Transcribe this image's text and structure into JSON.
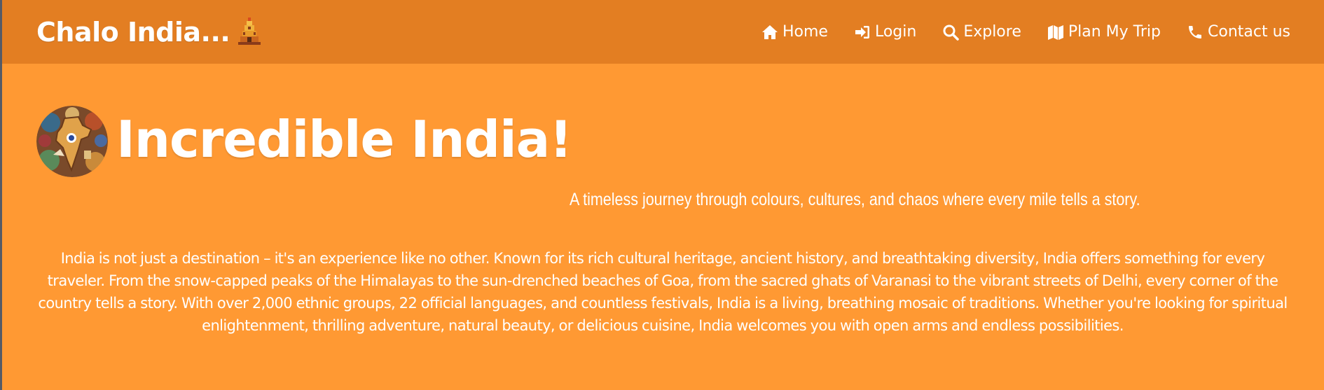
{
  "brand": {
    "name": "Chalo India...",
    "icon": "temple-icon"
  },
  "nav": {
    "items": [
      {
        "label": "Home",
        "icon": "home-icon"
      },
      {
        "label": "Login",
        "icon": "login-icon"
      },
      {
        "label": "Explore",
        "icon": "search-icon"
      },
      {
        "label": "Plan My Trip",
        "icon": "map-icon"
      },
      {
        "label": "Contact us",
        "icon": "phone-icon"
      }
    ]
  },
  "hero": {
    "title": "Incredible India!",
    "logo": "india-map-logo",
    "tagline": "A timeless journey through colours, cultures, and chaos where every mile tells a story.",
    "description": "India is not just a destination – it's an experience like no other. Known for its rich cultural heritage, ancient history, and breathtaking diversity, India offers something for every traveler. From the snow-capped peaks of the Himalayas to the sun-drenched beaches of Goa, from the sacred ghats of Varanasi to the vibrant streets of Delhi, every corner of the country tells a story. With over 2,000 ethnic groups, 22 official languages, and countless festivals, India is a living, breathing mosaic of traditions. Whether you're looking for spiritual enlightenment, thrilling adventure, natural beauty, or delicious cuisine, India welcomes you with open arms and endless possibilities."
  },
  "colors": {
    "navbar_bg": "#e37e22",
    "page_bg": "#ff9933",
    "text": "#ffffff"
  }
}
